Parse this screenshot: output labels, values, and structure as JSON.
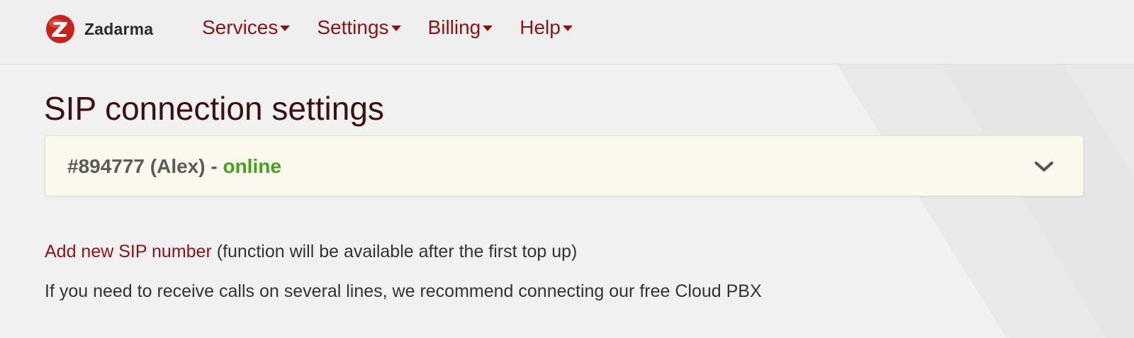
{
  "brand": {
    "name": "Zadarma",
    "logo_letter": "Z",
    "accent_color": "#8d1414"
  },
  "nav": {
    "items": [
      {
        "label": "Services",
        "icon": "caret-down-icon"
      },
      {
        "label": "Settings",
        "icon": "caret-down-icon"
      },
      {
        "label": "Billing",
        "icon": "caret-down-icon"
      },
      {
        "label": "Help",
        "icon": "caret-down-icon"
      }
    ]
  },
  "page": {
    "title": "SIP connection settings"
  },
  "sip": {
    "account_label": "#894777 (Alex) - ",
    "status": "online",
    "status_color": "#44a21e",
    "expand_icon": "chevron-down-icon"
  },
  "actions": {
    "add_sip_link": "Add new SIP number",
    "add_sip_note": " (function will be available after the first top up)"
  },
  "info": {
    "text": "If you need to receive calls on several lines, we recommend connecting our free Cloud PBX"
  }
}
